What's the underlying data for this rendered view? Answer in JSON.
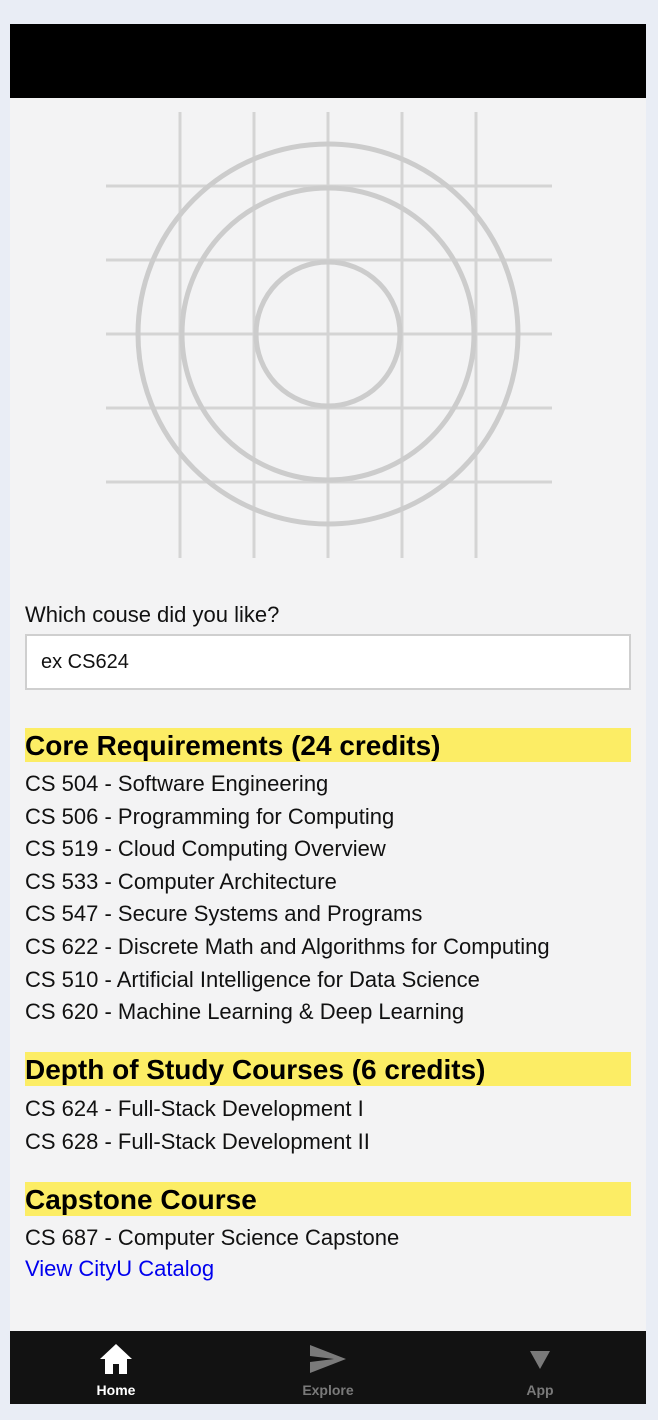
{
  "search": {
    "question": "Which couse did you like?",
    "placeholder": "ex CS624"
  },
  "sections": [
    {
      "heading": "Core Requirements (24 credits)",
      "courses": [
        "CS 504 - Software Engineering",
        "CS 506 - Programming for Computing",
        "CS 519 - Cloud Computing Overview",
        "CS 533 - Computer Architecture",
        "CS 547 - Secure Systems and Programs",
        "CS 622 - Discrete Math and Algorithms for Computing",
        "CS 510 - Artificial Intelligence for Data Science",
        "CS 620 - Machine Learning & Deep Learning"
      ]
    },
    {
      "heading": "Depth of Study Courses (6 credits)",
      "courses": [
        "CS 624 - Full-Stack Development I",
        "CS 628 - Full-Stack Development II"
      ]
    },
    {
      "heading": "Capstone Course",
      "courses": [
        "CS 687 - Computer Science Capstone"
      ]
    }
  ],
  "catalog_link": "View CityU Catalog",
  "tabs": [
    {
      "label": "Home",
      "icon": "home-icon",
      "active": true
    },
    {
      "label": "Explore",
      "icon": "send-icon",
      "active": false
    },
    {
      "label": "App",
      "icon": "triangle-down-icon",
      "active": false
    }
  ],
  "colors": {
    "highlight": "#fced65",
    "link": "#0000ee",
    "tab_active": "#ffffff",
    "tab_inactive": "#7a7a7a"
  }
}
